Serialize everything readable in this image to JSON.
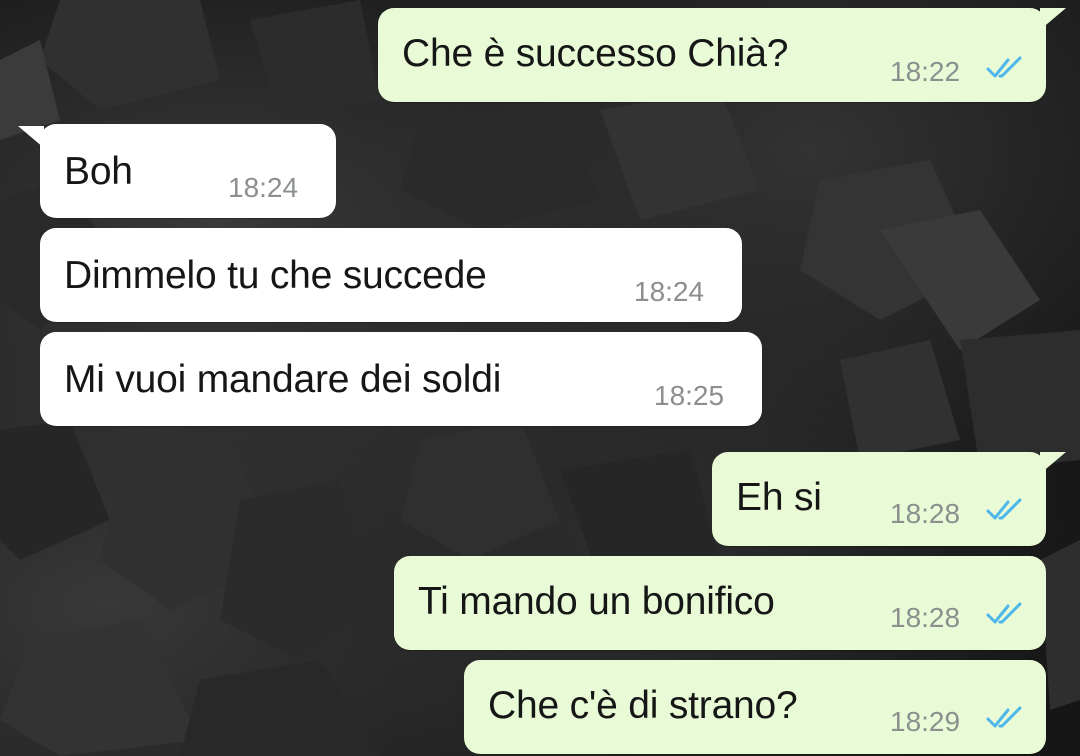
{
  "messages": [
    {
      "text": "Che è successo Chià?",
      "time": "18:22",
      "direction": "out",
      "status": "read-ticks-icon"
    },
    {
      "text": "Boh",
      "time": "18:24",
      "direction": "in"
    },
    {
      "text": "Dimmelo tu che succede",
      "time": "18:24",
      "direction": "in"
    },
    {
      "text": "Mi vuoi mandare dei soldi",
      "time": "18:25",
      "direction": "in"
    },
    {
      "text": "Eh si",
      "time": "18:28",
      "direction": "out",
      "status": "read-ticks-icon"
    },
    {
      "text": "Ti mando un bonifico",
      "time": "18:28",
      "direction": "out",
      "status": "read-ticks-icon"
    },
    {
      "text": "Che c'è di strano?",
      "time": "18:29",
      "direction": "out",
      "status": "read-ticks-icon"
    }
  ],
  "colors": {
    "outgoing_bubble": "#e8fbd6",
    "incoming_bubble": "#ffffff",
    "read_ticks": "#4fb6ec",
    "timestamp": "#8b8f8e"
  }
}
